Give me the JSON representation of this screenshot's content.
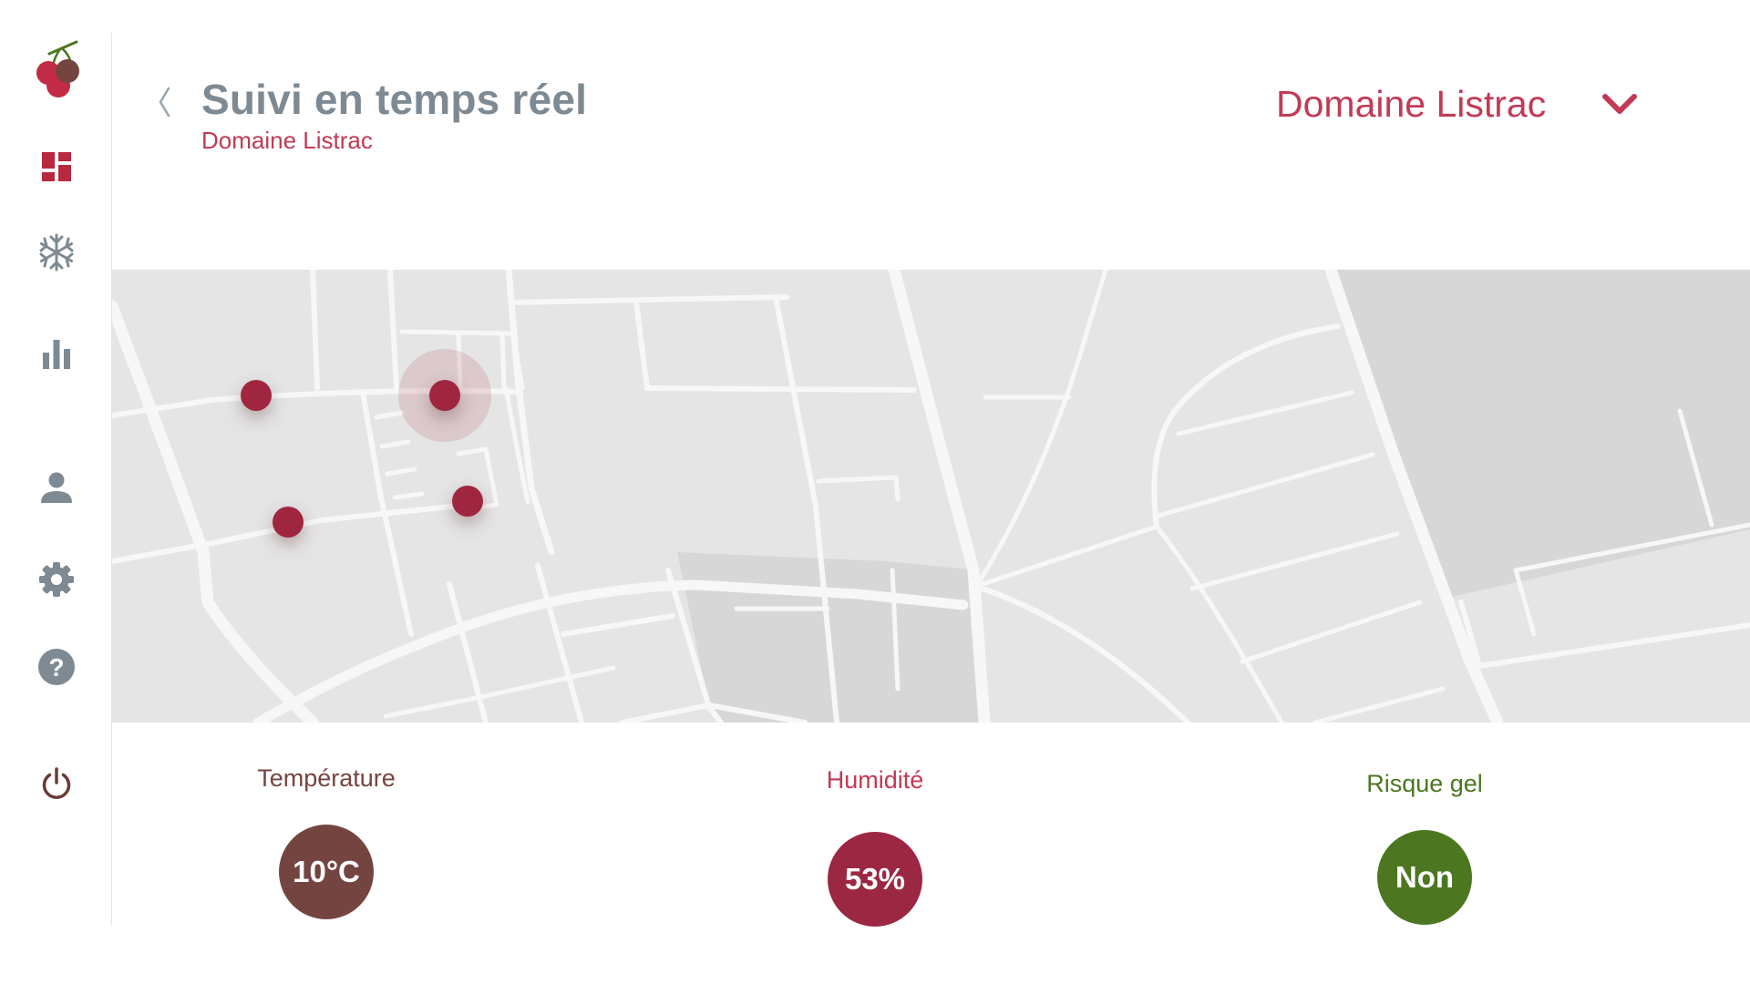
{
  "header": {
    "title": "Suivi en temps réel",
    "subtitle": "Domaine Listrac",
    "back_icon": "chevron-left-icon"
  },
  "estate_selector": {
    "selected": "Domaine Listrac",
    "icon": "chevron-down-icon"
  },
  "sidebar": {
    "logo_icon": "grapes-logo-icon",
    "items": [
      {
        "id": "dashboard",
        "icon": "dashboard-icon"
      },
      {
        "id": "frost",
        "icon": "snowflake-icon"
      },
      {
        "id": "statistics",
        "icon": "bar-chart-icon"
      },
      {
        "id": "account",
        "icon": "user-icon"
      },
      {
        "id": "settings",
        "icon": "gear-icon"
      },
      {
        "id": "help",
        "icon": "help-icon"
      },
      {
        "id": "logout",
        "icon": "power-icon"
      }
    ]
  },
  "map": {
    "markers": [
      {
        "id": "sensor-1",
        "active": false
      },
      {
        "id": "sensor-2",
        "active": true
      },
      {
        "id": "sensor-3",
        "active": false
      },
      {
        "id": "sensor-4",
        "active": false
      }
    ]
  },
  "metrics": [
    {
      "id": "temperature",
      "label": "Température",
      "value": "10°C",
      "color": "#744540"
    },
    {
      "id": "humidity",
      "label": "Humidité",
      "value": "53%",
      "color": "#9c2742"
    },
    {
      "id": "frost-risk",
      "label": "Risque gel",
      "value": "Non",
      "color": "#4c7720"
    }
  ],
  "colors": {
    "accent": "#c23a55",
    "title": "#7d8a93",
    "icon_red": "#b8293f",
    "icon_grey": "#7d8a93",
    "power": "#6a3b36",
    "marker": "#a0253f",
    "map_bg": "#e5e5e5",
    "map_block": "#d7d7d7",
    "road": "#f7f7f7"
  }
}
